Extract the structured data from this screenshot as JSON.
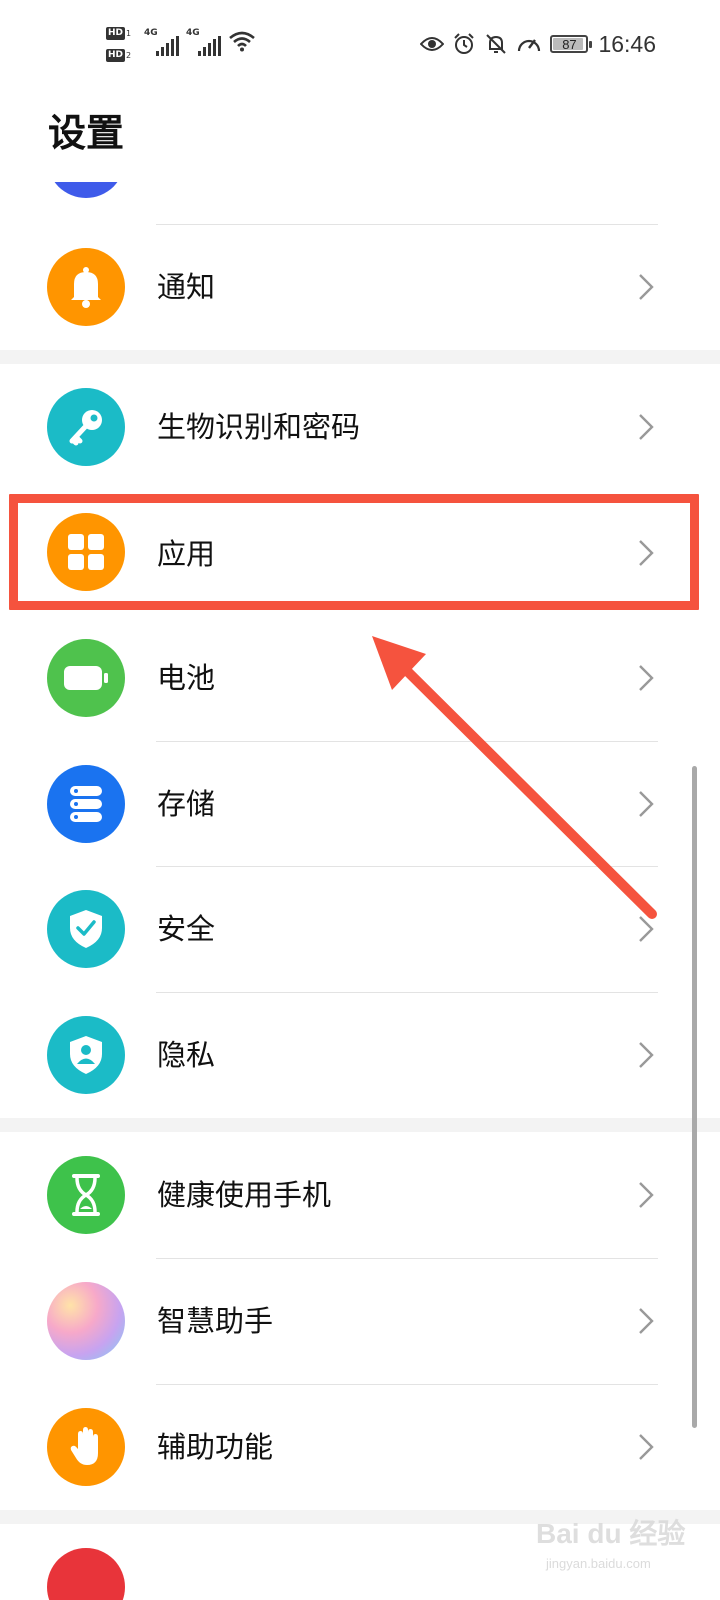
{
  "status_bar": {
    "hd1": "HD",
    "hd1_num": "1",
    "hd2": "HD",
    "hd2_num": "2",
    "net1": "4G",
    "net2": "4G",
    "battery_level": "87",
    "time": "16:46",
    "icons": [
      "eye-comfort-icon",
      "alarm-icon",
      "silent-bell-icon",
      "speed-gauge-icon"
    ]
  },
  "page": {
    "title": "设置"
  },
  "settings": {
    "items": [
      {
        "label": "通知",
        "icon": "bell-icon",
        "color": "#ff9500"
      },
      {
        "label": "生物识别和密码",
        "icon": "key-icon",
        "color": "#1bbbc7"
      },
      {
        "label": "应用",
        "icon": "apps-grid-icon",
        "color": "#ff9500"
      },
      {
        "label": "电池",
        "icon": "battery-icon",
        "color": "#4fc24d"
      },
      {
        "label": "存储",
        "icon": "storage-icon",
        "color": "#1a73f0"
      },
      {
        "label": "安全",
        "icon": "shield-check-icon",
        "color": "#1bbbc7"
      },
      {
        "label": "隐私",
        "icon": "privacy-shield-icon",
        "color": "#1bbbc7"
      },
      {
        "label": "健康使用手机",
        "icon": "hourglass-icon",
        "color": "#3ec24b"
      },
      {
        "label": "智慧助手",
        "icon": "assistant-icon",
        "color": "#d99be3"
      },
      {
        "label": "辅助功能",
        "icon": "hand-icon",
        "color": "#ff9500"
      }
    ]
  },
  "annotation": {
    "highlight_color": "#f5533e"
  },
  "watermark": {
    "main": "Bai du 经验",
    "sub": "jingyan.baidu.com"
  }
}
